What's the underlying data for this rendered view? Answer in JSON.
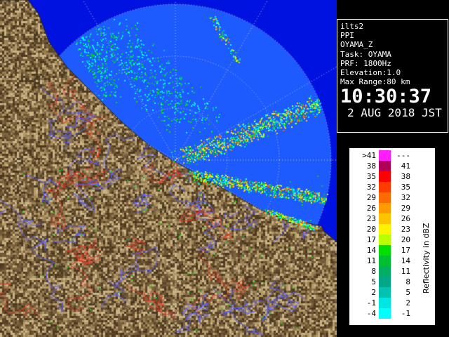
{
  "info": {
    "lines": [
      "ilts2",
      "PPI",
      "OYAMA_Z",
      "Task: OYAMA",
      "PRF: 1800Hz",
      "Elevation:1.0",
      "Max Range:80 km"
    ],
    "time": "10:30:37",
    "date": "2 AUG 2018 JST"
  },
  "legend": {
    "title": "Reflectivity in dBZ",
    "rows": [
      {
        "label": ">41",
        "upper": "---",
        "color": "#ff1dff"
      },
      {
        "label": "38",
        "upper": "41",
        "color": "#b0005a"
      },
      {
        "label": "35",
        "upper": "38",
        "color": "#ff0000"
      },
      {
        "label": "32",
        "upper": "35",
        "color": "#ff3b00"
      },
      {
        "label": "29",
        "upper": "32",
        "color": "#ff6a00"
      },
      {
        "label": "26",
        "upper": "29",
        "color": "#ff9a00"
      },
      {
        "label": "23",
        "upper": "26",
        "color": "#ffc400"
      },
      {
        "label": "20",
        "upper": "23",
        "color": "#fff200"
      },
      {
        "label": "17",
        "upper": "20",
        "color": "#b8ff00"
      },
      {
        "label": "14",
        "upper": "17",
        "color": "#00e000"
      },
      {
        "label": "11",
        "upper": "14",
        "color": "#00c030"
      },
      {
        "label": "8",
        "upper": "11",
        "color": "#00b060"
      },
      {
        "label": "5",
        "upper": "8",
        "color": "#00a888"
      },
      {
        "label": "2",
        "upper": "5",
        "color": "#00c4b0"
      },
      {
        "label": "-1",
        "upper": "2",
        "color": "#00e6e0"
      },
      {
        "label": "-4",
        "upper": "-1",
        "color": "#00ffff"
      }
    ]
  },
  "colors": {
    "sea": "#1e5bff",
    "out_of_range": "#0012e0",
    "range_rings": "#c8c8c8",
    "land": "#8a7048",
    "rivers": "#5a60ff",
    "roads": "#e03a2a"
  }
}
